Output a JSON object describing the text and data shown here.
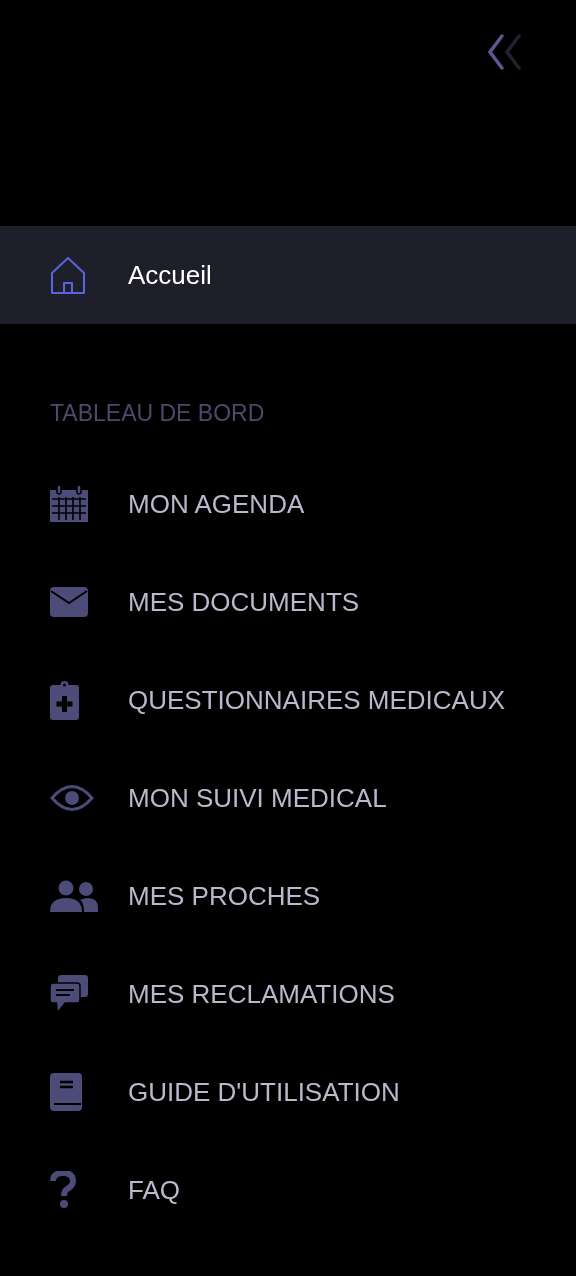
{
  "home": {
    "label": "Accueil",
    "kind": "home",
    "selected": true
  },
  "section": {
    "title": "TABLEAU DE BORD"
  },
  "items": [
    {
      "label": "MON AGENDA",
      "kind": "calendar",
      "selected": false
    },
    {
      "label": "MES DOCUMENTS",
      "kind": "envelope",
      "selected": false
    },
    {
      "label": "QUESTIONNAIRES MEDICAUX",
      "kind": "clipboard",
      "selected": false
    },
    {
      "label": "MON SUIVI MEDICAL",
      "kind": "eye",
      "selected": false
    },
    {
      "label": "MES PROCHES",
      "kind": "users",
      "selected": false
    },
    {
      "label": "MES RECLAMATIONS",
      "kind": "chat",
      "selected": false
    },
    {
      "label": "GUIDE D'UTILISATION",
      "kind": "book",
      "selected": false
    },
    {
      "label": "FAQ",
      "kind": "question",
      "selected": false
    }
  ]
}
